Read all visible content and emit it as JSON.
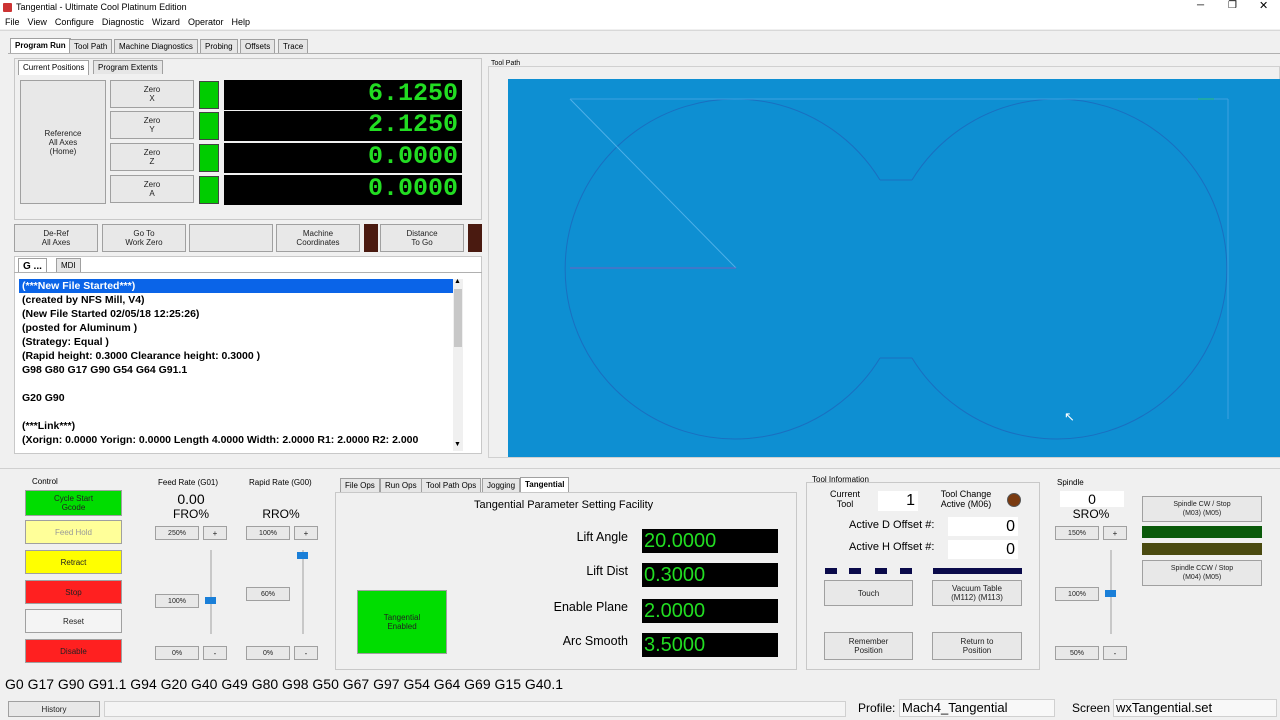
{
  "window": {
    "title": "Tangential - Ultimate Cool Platinum Edition"
  },
  "menu": [
    "File",
    "View",
    "Configure",
    "Diagnostic",
    "Wizard",
    "Operator",
    "Help"
  ],
  "main_tabs": [
    "Program Run",
    "Tool Path",
    "Machine Diagnostics",
    "Probing",
    "Offsets",
    "Trace"
  ],
  "pos_tabs": [
    "Current Positions",
    "Program Extents"
  ],
  "reference_all": "Reference\nAll Axes\n(Home)",
  "axes": [
    {
      "zero_label": "Zero\nX",
      "value": "6.1250"
    },
    {
      "zero_label": "Zero\nY",
      "value": "2.1250"
    },
    {
      "zero_label": "Zero\nZ",
      "value": "0.0000"
    },
    {
      "zero_label": "Zero\nA",
      "value": "0.0000"
    }
  ],
  "pos_buttons": {
    "deref": "De-Ref\nAll Axes",
    "goto_zero": "Go To\nWork Zero",
    "blank": "",
    "machine_coords": "Machine\nCoordinates",
    "distance_to_go": "Distance\nTo Go"
  },
  "gcode_tabs": [
    "G ...",
    "MDI"
  ],
  "gcode_lines": [
    "(***New File Started***)",
    "(created by NFS Mill, V4)",
    "(New File Started 02/05/18 12:25:26)",
    "(posted for Aluminum )",
    "(Strategy: Equal )",
    "(Rapid height: 0.3000  Clearance height: 0.3000 )",
    "G98 G80 G17 G90 G54 G64 G91.1",
    "",
    "G20 G90",
    "",
    "(***Link***)",
    "(Xorign: 0.0000  Yorign: 0.0000  Length 4.0000  Width: 2.0000  R1: 2.0000  R2: 2.000"
  ],
  "toolpath_label": "Tool Path",
  "control": {
    "title": "Control",
    "cycle_start": "Cycle Start\nGcode",
    "feed_hold": "Feed Hold",
    "retract": "Retract",
    "stop": "Stop",
    "reset": "Reset",
    "disable": "Disable"
  },
  "feed": {
    "title": "Feed Rate (G01)",
    "value": "0.00",
    "label": "FRO%",
    "max": "250%",
    "plus": "+",
    "current": "100%",
    "min": "0%",
    "minus": "-"
  },
  "rapid": {
    "title": "Rapid Rate (G00)",
    "label": "RRO%",
    "max": "100%",
    "plus": "+",
    "current": "60%",
    "min": "0%",
    "minus": "-"
  },
  "ops_tabs": [
    "File Ops",
    "Run Ops",
    "Tool Path Ops",
    "Jogging",
    "Tangential"
  ],
  "tangential": {
    "title": "Tangential Parameter Setting Facility",
    "enabled_btn": "Tangential\nEnabled",
    "params": [
      {
        "label": "Lift Angle",
        "value": "20.0000"
      },
      {
        "label": "Lift Dist",
        "value": "0.3000"
      },
      {
        "label": "Enable Plane",
        "value": "2.0000"
      },
      {
        "label": "Arc Smooth",
        "value": "3.5000"
      }
    ]
  },
  "tool": {
    "title": "Tool Information",
    "current_tool_label": "Current\nTool",
    "current_tool": "1",
    "tool_change_label": "Tool Change\nActive (M06)",
    "d_offset_label": "Active D Offset #:",
    "d_offset": "0",
    "h_offset_label": "Active H Offset #:",
    "h_offset": "0",
    "touch": "Touch",
    "vacuum": "Vacuum Table\n(M112) (M113)",
    "remember": "Remember\nPosition",
    "return": "Return to\nPosition"
  },
  "spindle": {
    "title": "Spindle",
    "value": "0",
    "label": "SRO%",
    "max": "150%",
    "plus": "+",
    "current": "100%",
    "min": "50%",
    "minus": "-",
    "cw": "Spindle CW / Stop\n(M03)          (M05)",
    "ccw": "Spindle CCW / Stop\n(M04)          (M05)"
  },
  "modal_codes": "G0 G17 G90 G91.1 G94 G20 G40 G49 G80 G98 G50 G67 G97 G54 G64 G69 G15 G40.1",
  "status": {
    "history": "History",
    "profile_label": "Profile:",
    "profile": "Mach4_Tangential",
    "screen_label": "Screen",
    "screen": "wxTangential.set"
  },
  "colors": {
    "dro_bg": "#000000",
    "dro_text": "#22dd22",
    "toolpath_bg": "#0e8fd2",
    "cycle_start": "#00dd00",
    "feed_hold": "#ffff99",
    "retract": "#ffff00",
    "stop": "#ff2020",
    "disable": "#ff2020"
  }
}
